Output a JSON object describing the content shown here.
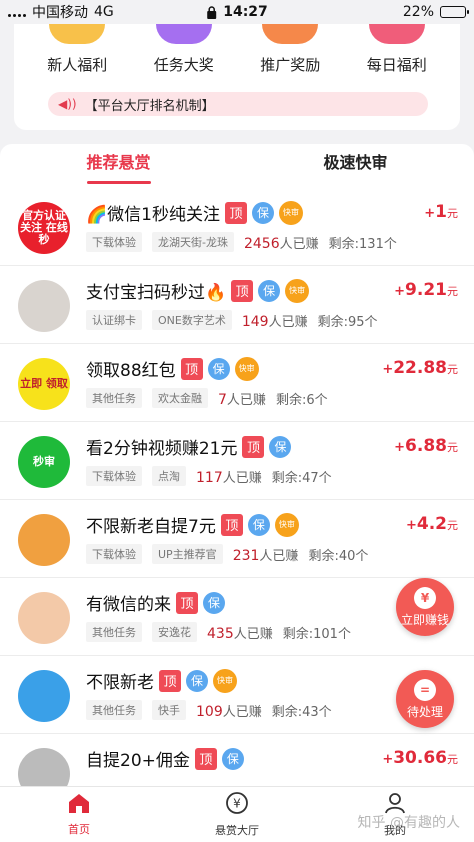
{
  "status_bar": {
    "carrier": "中国移动",
    "network": "4G",
    "time": "14:27",
    "battery": "22%",
    "battery_level": 0.22
  },
  "quick_actions": [
    {
      "label": "新人福利",
      "icon": "gift-icon",
      "color": "#f8c14a"
    },
    {
      "label": "任务大奖",
      "icon": "task-icon",
      "color": "#a56ff0"
    },
    {
      "label": "推广奖励",
      "icon": "promo-icon",
      "color": "#f5884a"
    },
    {
      "label": "每日福利",
      "icon": "daily-icon",
      "color": "#f05d7a"
    }
  ],
  "notice": {
    "text": "【平台大厅排名机制】",
    "icon": "speaker-icon"
  },
  "tabs": {
    "recommended": "推荐悬赏",
    "fast_review": "极速快审"
  },
  "tags": {
    "top": "顶",
    "guarantee": "保",
    "fast": "快审"
  },
  "units": {
    "earned_suffix": "人已赚",
    "remaining_prefix": "剩余:",
    "remaining_suffix": "个",
    "yuan": "元",
    "plus": "+"
  },
  "tasks": [
    {
      "title": "🌈微信1秒纯关注",
      "tags": [
        "top",
        "guarantee",
        "fast"
      ],
      "category": "下载体验",
      "merchant": "龙湖天街-龙珠",
      "earned": "2456",
      "remaining": "131",
      "price": "1",
      "avatar_text": "官方认证 关注 在线秒",
      "avatar_color": "#e8202c"
    },
    {
      "title": "支付宝扫码秒过🔥",
      "tags": [
        "top",
        "guarantee",
        "fast"
      ],
      "category": "认证绑卡",
      "merchant": "ONE数字艺术",
      "earned": "149",
      "remaining": "95",
      "price": "9.21",
      "avatar_text": "",
      "avatar_color": "#d9d4cf"
    },
    {
      "title": "领取88红包",
      "tags": [
        "top",
        "guarantee",
        "fast"
      ],
      "category": "其他任务",
      "merchant": "欢太金融",
      "earned": "7",
      "remaining": "6",
      "price": "22.88",
      "avatar_text": "立即 领取",
      "avatar_color": "#f7e21b"
    },
    {
      "title": "看2分钟视频赚21元",
      "tags": [
        "top",
        "guarantee"
      ],
      "category": "下载体验",
      "merchant": "点淘",
      "earned": "117",
      "remaining": "47",
      "price": "6.88",
      "avatar_text": "秒审",
      "avatar_color": "#1fba3a"
    },
    {
      "title": "不限新老自提7元",
      "tags": [
        "top",
        "guarantee",
        "fast"
      ],
      "category": "下载体验",
      "merchant": "UP主推荐官",
      "earned": "231",
      "remaining": "40",
      "price": "4.2",
      "avatar_text": "",
      "avatar_color": "#f0a040"
    },
    {
      "title": "有微信的来",
      "tags": [
        "top",
        "guarantee"
      ],
      "category": "其他任务",
      "merchant": "安逸花",
      "earned": "435",
      "remaining": "101",
      "price": "",
      "avatar_text": "",
      "avatar_color": "#f3c9a8"
    },
    {
      "title": "不限新老",
      "tags": [
        "top",
        "guarantee",
        "fast"
      ],
      "category": "其他任务",
      "merchant": "快手",
      "earned": "109",
      "remaining": "43",
      "price": "",
      "avatar_text": "",
      "avatar_color": "#3aa0e8"
    },
    {
      "title": "自提20+佣金",
      "tags": [
        "top",
        "guarantee"
      ],
      "category": "",
      "merchant": "",
      "earned": "",
      "remaining": "",
      "price": "30.66",
      "avatar_text": "",
      "avatar_color": "#bbbbbb"
    }
  ],
  "float_buttons": {
    "earn_now": "立即赚钱",
    "pending": "待处理"
  },
  "bottom_nav": [
    {
      "label": "首页",
      "icon": "home-icon",
      "active": true
    },
    {
      "label": "悬赏大厅",
      "icon": "yuan-coin-icon",
      "active": false
    },
    {
      "label": "我的",
      "icon": "profile-icon",
      "active": false
    }
  ],
  "watermark": "知乎 @有趣的人",
  "colors": {
    "accent": "#e8384c",
    "price": "#e02a3a",
    "notice_bg": "#fde4e7"
  }
}
